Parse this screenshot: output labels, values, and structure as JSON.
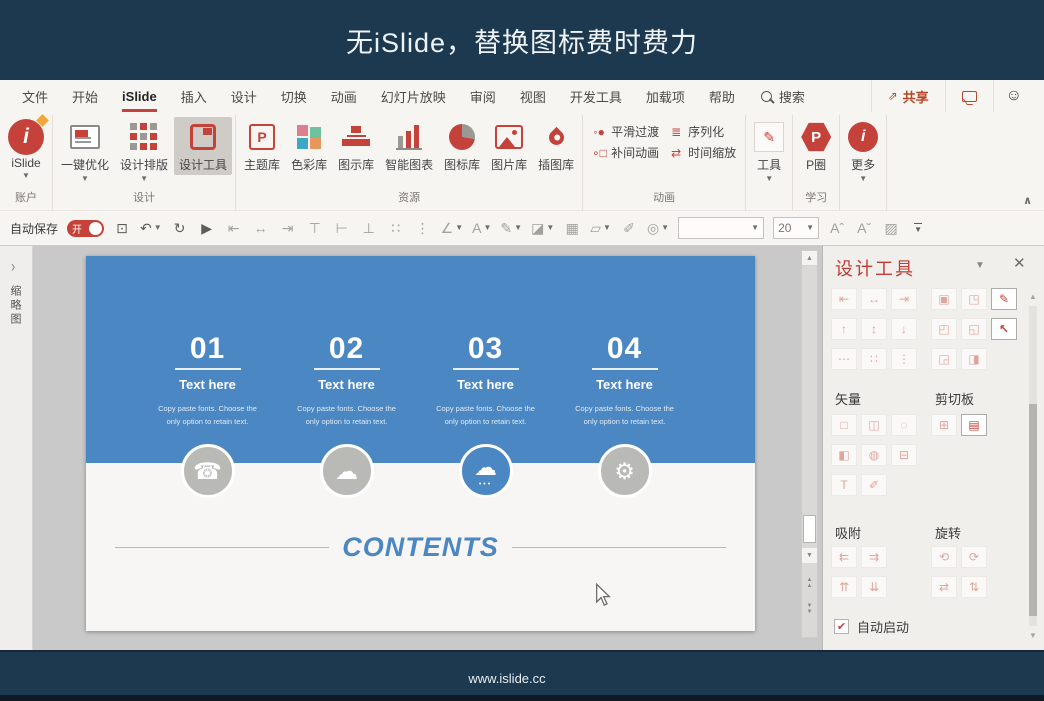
{
  "title_bar": {
    "title": "无iSlide，替换图标费时费力"
  },
  "tabs": {
    "items": [
      "文件",
      "开始",
      "iSlide",
      "插入",
      "设计",
      "切换",
      "动画",
      "幻灯片放映",
      "审阅",
      "视图",
      "开发工具",
      "加载项",
      "帮助"
    ],
    "active_tab": "iSlide",
    "search_label": "搜索",
    "share_label": "共享"
  },
  "ribbon": {
    "account": {
      "button": "iSlide",
      "group_label": "账户"
    },
    "design": {
      "buttons": [
        "一键优化",
        "设计排版",
        "设计工具"
      ],
      "selected_button": "设计工具",
      "group_label": "设计"
    },
    "resources": {
      "buttons": [
        "主题库",
        "色彩库",
        "图示库",
        "智能图表",
        "图标库",
        "图片库",
        "插图库"
      ],
      "group_label": "资源"
    },
    "animation": {
      "buttons": [
        "平滑过渡",
        "序列化",
        "补间动画",
        "时间缩放"
      ],
      "group_label": "动画"
    },
    "tools": {
      "button": "工具"
    },
    "learn": {
      "button": "P圈",
      "group_label": "学习"
    },
    "more": {
      "button": "更多"
    }
  },
  "qat": {
    "autosave_label": "自动保存",
    "autosave_state": "开",
    "font_size": "20"
  },
  "left_bar": {
    "vertical_label": "缩略图"
  },
  "slide": {
    "steps": [
      {
        "num": "01",
        "title": "Text here",
        "desc1": "Copy paste fonts. Choose the",
        "desc2": "only option to retain text.",
        "icon": "phone-contact-icon",
        "glyph": "☎",
        "active": false
      },
      {
        "num": "02",
        "title": "Text here",
        "desc1": "Copy paste fonts. Choose the",
        "desc2": "only option to retain text.",
        "icon": "cloud-icon",
        "glyph": "☁",
        "active": false
      },
      {
        "num": "03",
        "title": "Text here",
        "desc1": "Copy paste fonts. Choose the",
        "desc2": "only option to retain text.",
        "icon": "cloud-network-icon",
        "glyph": "☁",
        "active": true
      },
      {
        "num": "04",
        "title": "Text here",
        "desc1": "Copy paste fonts. Choose the",
        "desc2": "only option to retain text.",
        "icon": "gear-icon",
        "glyph": "⚙",
        "active": false
      }
    ],
    "contents_title": "CONTENTS"
  },
  "panel": {
    "title": "设计工具",
    "vector_label": "矢量",
    "clipboard_label": "剪切板",
    "snap_label": "吸附",
    "rotate_label": "旋转",
    "autostart_label": "自动启动",
    "autostart_checked": true
  },
  "footer": {
    "url": "www.islide.cc"
  },
  "colors": {
    "navy": "#1d3950",
    "accent_red": "#c5423b",
    "slide_blue": "#4a87c3"
  }
}
